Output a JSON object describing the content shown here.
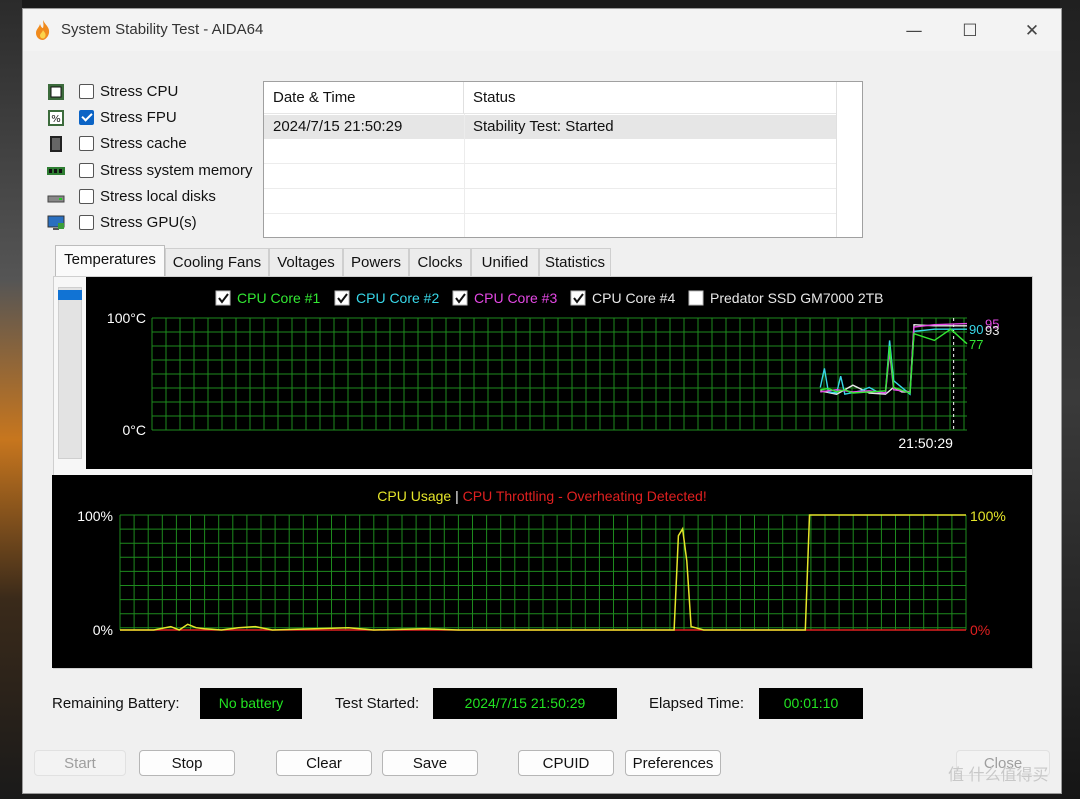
{
  "window": {
    "title": "System Stability Test - AIDA64",
    "controls": {
      "minimize": "—",
      "maximize": "☐",
      "close": "✕"
    }
  },
  "stress_options": [
    {
      "label": "Stress CPU",
      "checked": false,
      "icon": "cpu-chip-icon"
    },
    {
      "label": "Stress FPU",
      "checked": true,
      "icon": "fpu-percent-icon"
    },
    {
      "label": "Stress cache",
      "checked": false,
      "icon": "cache-icon"
    },
    {
      "label": "Stress system memory",
      "checked": false,
      "icon": "memory-module-icon"
    },
    {
      "label": "Stress local disks",
      "checked": false,
      "icon": "disk-drive-icon"
    },
    {
      "label": "Stress GPU(s)",
      "checked": false,
      "icon": "monitor-gpu-icon"
    }
  ],
  "log": {
    "columns": [
      "Date & Time",
      "Status"
    ],
    "rows": [
      {
        "datetime": "2024/7/15 21:50:29",
        "status": "Stability Test: Started"
      }
    ]
  },
  "tabs": [
    "Temperatures",
    "Cooling Fans",
    "Voltages",
    "Powers",
    "Clocks",
    "Unified",
    "Statistics"
  ],
  "active_tab": "Temperatures",
  "chart_data": [
    {
      "type": "line",
      "name": "temperatures",
      "legend": [
        {
          "label": "CPU Core #1",
          "checked": true,
          "color": "#33e833"
        },
        {
          "label": "CPU Core #2",
          "checked": true,
          "color": "#38d7e8"
        },
        {
          "label": "CPU Core #3",
          "checked": true,
          "color": "#e448e4"
        },
        {
          "label": "CPU Core #4",
          "checked": true,
          "color": "#e8e8e8"
        },
        {
          "label": "Predator SSD GM7000 2TB",
          "checked": false,
          "color": "#e8e8e8"
        }
      ],
      "y_top_label": "100°C",
      "y_bottom_label": "0°C",
      "ylim": [
        0,
        100
      ],
      "x_marker_label": "21:50:29",
      "x_marker_at": 0.91,
      "end_labels": [
        {
          "text": "90",
          "value": 90,
          "color": "#38d7e8"
        },
        {
          "text": "95",
          "value": 95,
          "color": "#e448e4"
        },
        {
          "text": "93",
          "value": 93,
          "color": "#e8e8e8"
        },
        {
          "text": "77",
          "value": 77,
          "color": "#33e833"
        }
      ],
      "series": [
        {
          "color": "#e8e8e8",
          "points": [
            [
              0.82,
              35
            ],
            [
              0.84,
              32
            ],
            [
              0.86,
              40
            ],
            [
              0.88,
              33
            ],
            [
              0.9,
              32
            ],
            [
              0.91,
              38
            ],
            [
              0.92,
              34
            ],
            [
              0.93,
              34
            ],
            [
              0.935,
              94
            ],
            [
              0.96,
              93
            ],
            [
              1,
              93
            ]
          ]
        },
        {
          "color": "#38d7e8",
          "points": [
            [
              0.82,
              38
            ],
            [
              0.825,
              55
            ],
            [
              0.83,
              34
            ],
            [
              0.84,
              33
            ],
            [
              0.845,
              48
            ],
            [
              0.85,
              32
            ],
            [
              0.87,
              35
            ],
            [
              0.88,
              38
            ],
            [
              0.89,
              34
            ],
            [
              0.9,
              33
            ],
            [
              0.905,
              80
            ],
            [
              0.91,
              44
            ],
            [
              0.92,
              38
            ],
            [
              0.93,
              32
            ],
            [
              0.935,
              88
            ],
            [
              0.96,
              90
            ],
            [
              1,
              90
            ]
          ]
        },
        {
          "color": "#e448e4",
          "points": [
            [
              0.82,
              34
            ],
            [
              0.84,
              36
            ],
            [
              0.86,
              34
            ],
            [
              0.88,
              35
            ],
            [
              0.9,
              33
            ],
            [
              0.905,
              70
            ],
            [
              0.91,
              36
            ],
            [
              0.93,
              34
            ],
            [
              0.935,
              92
            ],
            [
              0.96,
              94
            ],
            [
              1,
              95
            ]
          ]
        },
        {
          "color": "#33e833",
          "points": [
            [
              0.82,
              36
            ],
            [
              0.83,
              37
            ],
            [
              0.84,
              34
            ],
            [
              0.85,
              36
            ],
            [
              0.86,
              33
            ],
            [
              0.88,
              34
            ],
            [
              0.9,
              35
            ],
            [
              0.905,
              75
            ],
            [
              0.91,
              38
            ],
            [
              0.93,
              33
            ],
            [
              0.935,
              86
            ],
            [
              0.96,
              80
            ],
            [
              0.98,
              90
            ],
            [
              1,
              77
            ]
          ]
        }
      ]
    },
    {
      "type": "line",
      "name": "cpu-usage",
      "title_left": "CPU Usage",
      "title_separator": "|",
      "title_right": "CPU Throttling - Overheating Detected!",
      "title_left_color": "#e6e62a",
      "title_right_color": "#e02020",
      "y_left_top": "100%",
      "y_left_bottom": "0%",
      "y_right_top": "100%",
      "y_right_bottom": "0%",
      "ylim": [
        0,
        100
      ],
      "series": [
        {
          "name": "CPU Usage",
          "color": "#e6e62a",
          "points": [
            [
              0,
              0
            ],
            [
              0.04,
              0
            ],
            [
              0.06,
              3
            ],
            [
              0.07,
              0
            ],
            [
              0.08,
              5
            ],
            [
              0.09,
              2
            ],
            [
              0.1,
              1
            ],
            [
              0.12,
              0
            ],
            [
              0.14,
              2
            ],
            [
              0.16,
              3
            ],
            [
              0.18,
              0
            ],
            [
              0.27,
              2
            ],
            [
              0.3,
              0
            ],
            [
              0.36,
              1
            ],
            [
              0.4,
              0
            ],
            [
              0.44,
              0
            ],
            [
              0.46,
              0
            ],
            [
              0.64,
              0
            ],
            [
              0.655,
              0
            ],
            [
              0.66,
              82
            ],
            [
              0.665,
              88
            ],
            [
              0.67,
              60
            ],
            [
              0.675,
              3
            ],
            [
              0.68,
              2
            ],
            [
              0.69,
              0
            ],
            [
              0.8,
              0
            ],
            [
              0.81,
              0
            ],
            [
              0.815,
              100
            ],
            [
              1,
              100
            ]
          ]
        },
        {
          "name": "CPU Throttling",
          "color": "#e02020",
          "points": [
            [
              0,
              0
            ],
            [
              1,
              0
            ]
          ]
        }
      ]
    }
  ],
  "status": {
    "battery_label": "Remaining Battery:",
    "battery_value": "No battery",
    "started_label": "Test Started:",
    "started_value": "2024/7/15 21:50:29",
    "elapsed_label": "Elapsed Time:",
    "elapsed_value": "00:01:10"
  },
  "buttons": {
    "start": "Start",
    "stop": "Stop",
    "clear": "Clear",
    "save": "Save",
    "cpuid": "CPUID",
    "preferences": "Preferences",
    "close": "Close"
  },
  "watermark": "值 什么值得买"
}
